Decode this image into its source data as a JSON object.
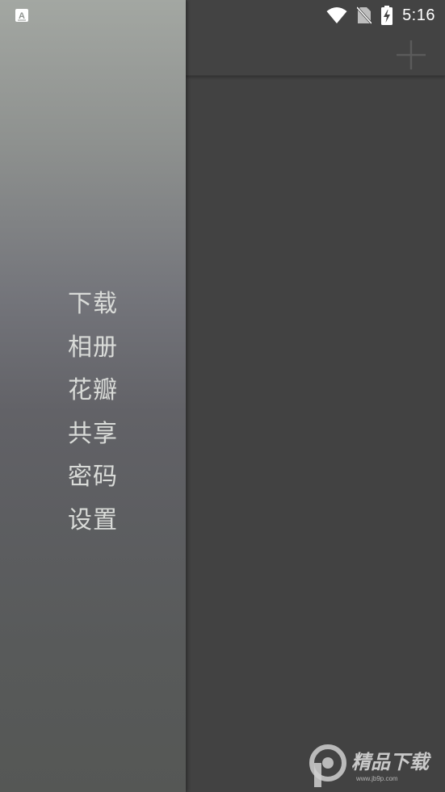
{
  "status_bar": {
    "time": "5:16",
    "icons": [
      "keyboard-a-icon",
      "wifi-icon",
      "no-sim-icon",
      "battery-charging-icon"
    ]
  },
  "toolbar": {
    "add_icon": "plus-icon"
  },
  "drawer": {
    "items": [
      {
        "label": "下载"
      },
      {
        "label": "相册"
      },
      {
        "label": "花瓣"
      },
      {
        "label": "共享"
      },
      {
        "label": "密码"
      },
      {
        "label": "设置"
      }
    ]
  },
  "watermark": {
    "brand": "精品下载",
    "url": "www.jb9p.com"
  },
  "colors": {
    "background": "#424242",
    "drawer_top": "#a3a7a2",
    "drawer_bottom": "#555755",
    "menu_text": "#d9dbd8"
  }
}
